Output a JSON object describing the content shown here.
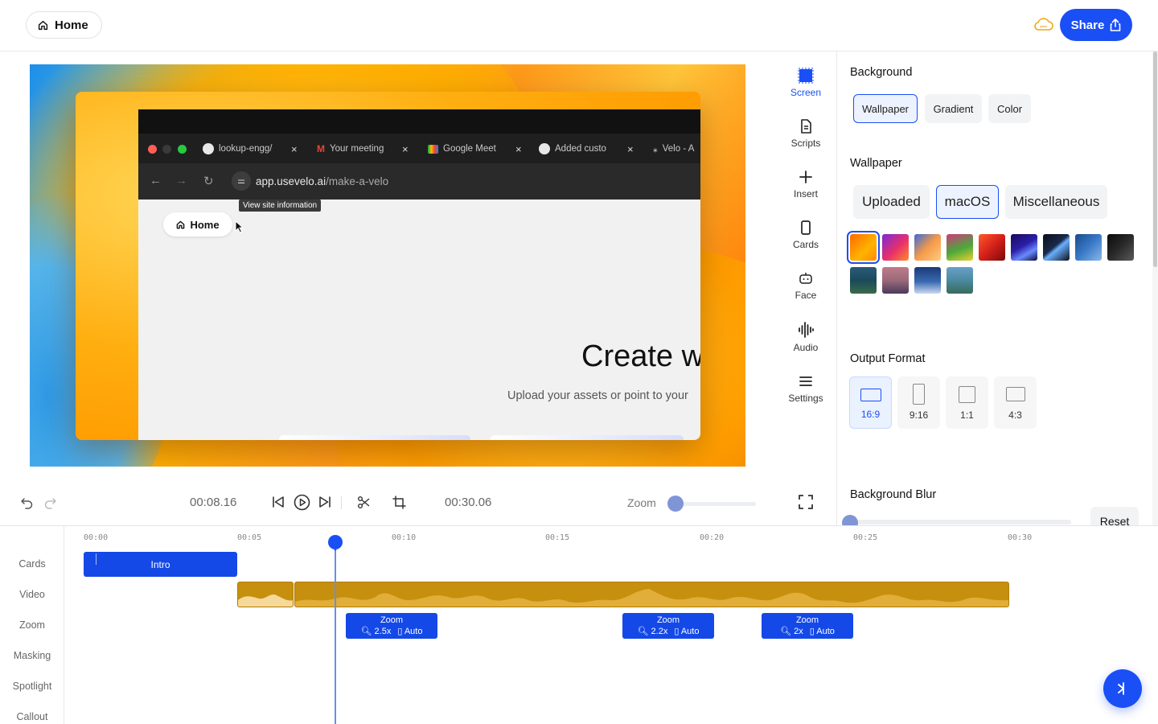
{
  "header": {
    "home_label": "Home",
    "share_label": "Share"
  },
  "preview": {
    "tabs": [
      {
        "label": "lookup-engg/"
      },
      {
        "label": "Your meeting"
      },
      {
        "label": "Google Meet"
      },
      {
        "label": "Added custo"
      },
      {
        "label": "Velo - A"
      }
    ],
    "address_host": "app.usevelo.ai",
    "address_path": "/make-a-velo",
    "tooltip": "View site information",
    "inner_home_label": "Home",
    "headline": "Create w",
    "subtext": "Upload your assets or point to your"
  },
  "tools": [
    {
      "label": "Screen",
      "icon": "screen-icon",
      "active": true
    },
    {
      "label": "Scripts",
      "icon": "document-icon"
    },
    {
      "label": "Insert",
      "icon": "plus-icon"
    },
    {
      "label": "Cards",
      "icon": "card-icon"
    },
    {
      "label": "Face",
      "icon": "robot-face-icon"
    },
    {
      "label": "Audio",
      "icon": "waveform-icon"
    },
    {
      "label": "Settings",
      "icon": "menu-icon"
    }
  ],
  "panel": {
    "background_title": "Background",
    "background_tabs": [
      "Wallpaper",
      "Gradient",
      "Color"
    ],
    "background_selected": "Wallpaper",
    "wallpaper_title": "Wallpaper",
    "wallpaper_tabs": [
      "Uploaded",
      "macOS",
      "Miscellaneous"
    ],
    "wallpaper_selected": "macOS",
    "thumbnail_colors": [
      "#ff8a00",
      "#e8306a",
      "#f59a4a",
      "#4aa83c",
      "#d4201a",
      "#2a1fa8",
      "#1a2a4a",
      "#3a7ac8",
      "#2a2a2a",
      "#1a4a5a",
      "#9a6a7a",
      "#3a6ab0",
      "#4a8aa0"
    ],
    "output_title": "Output Format",
    "formats": [
      "16:9",
      "9:16",
      "1:1",
      "4:3"
    ],
    "format_selected": "16:9",
    "blur_title": "Background Blur",
    "reset_label": "Reset"
  },
  "transport": {
    "current_time": "00:08.16",
    "total_time": "00:30.06",
    "zoom_label": "Zoom"
  },
  "timeline": {
    "ruler": [
      "00:00",
      "00:05",
      "00:10",
      "00:15",
      "00:20",
      "00:25",
      "00:30"
    ],
    "tracks": [
      "Cards",
      "Video",
      "Zoom",
      "Masking",
      "Spotlight",
      "Callout"
    ],
    "intro_clip": "Intro",
    "zoom_clips": [
      {
        "title": "Zoom",
        "factor": "2.5x",
        "mode": "Auto"
      },
      {
        "title": "Zoom",
        "factor": "2.2x",
        "mode": "Auto"
      },
      {
        "title": "Zoom",
        "factor": "2x",
        "mode": "Auto"
      }
    ]
  }
}
